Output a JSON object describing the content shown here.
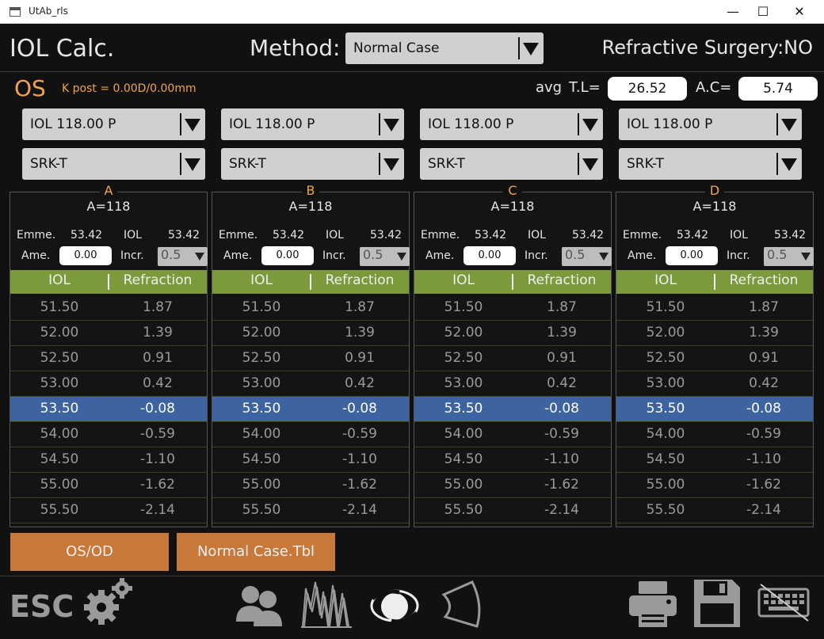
{
  "window": {
    "title": "UtAb_rls",
    "minimize": "—",
    "maximize": "☐",
    "close": "✕"
  },
  "header": {
    "title": "IOL Calc.",
    "method_label": "Method:",
    "method_value": "Normal Case",
    "refractive_surgery": "Refractive Surgery:NO"
  },
  "eye": {
    "side": "OS",
    "kpost": "K post = 0.00D/0.00mm"
  },
  "measurements": {
    "avg": "avg",
    "tl_label": "T.L=",
    "tl_value": "26.52",
    "ac_label": "A.C=",
    "ac_value": "5.74"
  },
  "iol_selectors": [
    "IOL 118.00 P",
    "IOL 118.00 P",
    "IOL 118.00 P",
    "IOL 118.00 P"
  ],
  "formula_selectors": [
    "SRK-T",
    "SRK-T",
    "SRK-T",
    "SRK-T"
  ],
  "panels": [
    {
      "letter": "A",
      "a_value": "A=118",
      "emme_label": "Emme.",
      "emme_value": "53.42",
      "iol_label": "IOL",
      "iol_value": "53.42",
      "ame_label": "Ame.",
      "ame_value": "0.00",
      "incr_label": "Incr.",
      "incr_value": "0.5"
    },
    {
      "letter": "B",
      "a_value": "A=118",
      "emme_label": "Emme.",
      "emme_value": "53.42",
      "iol_label": "IOL",
      "iol_value": "53.42",
      "ame_label": "Ame.",
      "ame_value": "0.00",
      "incr_label": "Incr.",
      "incr_value": "0.5"
    },
    {
      "letter": "C",
      "a_value": "A=118",
      "emme_label": "Emme.",
      "emme_value": "53.42",
      "iol_label": "IOL",
      "iol_value": "53.42",
      "ame_label": "Ame.",
      "ame_value": "0.00",
      "incr_label": "Incr.",
      "incr_value": "0.5"
    },
    {
      "letter": "D",
      "a_value": "A=118",
      "emme_label": "Emme.",
      "emme_value": "53.42",
      "iol_label": "IOL",
      "iol_value": "53.42",
      "ame_label": "Ame.",
      "ame_value": "0.00",
      "incr_label": "Incr.",
      "incr_value": "0.5"
    }
  ],
  "table": {
    "headers": [
      "IOL",
      "Refraction"
    ],
    "selected_index": 4,
    "rows": [
      [
        "51.50",
        "1.87"
      ],
      [
        "52.00",
        "1.39"
      ],
      [
        "52.50",
        "0.91"
      ],
      [
        "53.00",
        "0.42"
      ],
      [
        "53.50",
        "-0.08"
      ],
      [
        "54.00",
        "-0.59"
      ],
      [
        "54.50",
        "-1.10"
      ],
      [
        "55.00",
        "-1.62"
      ],
      [
        "55.50",
        "-2.14"
      ]
    ]
  },
  "buttons": {
    "os_od": "OS/OD",
    "normal_case_tbl": "Normal Case.Tbl"
  },
  "bottom": {
    "esc": "ESC",
    "icons": [
      "gear-icon",
      "patients-icon",
      "waveform-icon",
      "eye-icon",
      "cornea-icon",
      "printer-icon",
      "save-icon",
      "keyboard-icon"
    ]
  },
  "colors": {
    "accent": "#f0a34a",
    "table_header": "#7a9a3b",
    "selected_row": "#3d63a0",
    "button": "#c87838"
  }
}
